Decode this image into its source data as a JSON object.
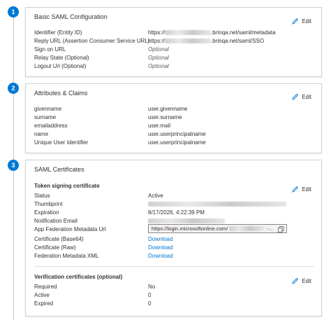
{
  "steps": [
    "1",
    "2",
    "3"
  ],
  "edit_label": "Edit",
  "saml": {
    "title": "Basic SAML Configuration",
    "rows": [
      {
        "key": "Identifier (Entity ID)",
        "prefix": "https://",
        "suffix": ".brinqa.net/saml/metadata"
      },
      {
        "key": "Reply URL (Assertion Consumer Service URL)",
        "prefix": "https://",
        "suffix": ".brinqa.net/saml/SSO"
      },
      {
        "key": "Sign on URL",
        "value": "Optional"
      },
      {
        "key": "Relay State (Optional)",
        "value": "Optional"
      },
      {
        "key": "Logout Url (Optional)",
        "value": "Optional"
      }
    ]
  },
  "claims": {
    "title": "Attributes & Claims",
    "rows": [
      {
        "key": "givenname",
        "value": "user.givenname"
      },
      {
        "key": "surname",
        "value": "user.surname"
      },
      {
        "key": "emailaddress",
        "value": "user.mail"
      },
      {
        "key": "name",
        "value": "user.userprincipalname"
      },
      {
        "key": "Unique User Identifier",
        "value": "user.userprincipalname"
      }
    ]
  },
  "certs": {
    "title": "SAML Certificates",
    "token_heading": "Token signing certificate",
    "status_key": "Status",
    "status_value": "Active",
    "thumbprint_key": "Thumbprint",
    "expiration_key": "Expiration",
    "expiration_value": "8/17/2026, 4:22:39 PM",
    "notification_key": "Notification Email",
    "metadata_key": "App Federation Metadata Url",
    "metadata_value": "https://login.microsoftonline.com/",
    "metadata_tail": "-...",
    "base64_key": "Certificate (Base64)",
    "base64_value": "Download",
    "raw_key": "Certificate (Raw)",
    "raw_value": "Download",
    "fedxml_key": "Federation Metadata XML",
    "fedxml_value": "Download",
    "verification_heading": "Verification certificates (optional)",
    "required_key": "Required",
    "required_value": "No",
    "active_key": "Active",
    "active_value": "0",
    "expired_key": "Expired",
    "expired_value": "0"
  }
}
